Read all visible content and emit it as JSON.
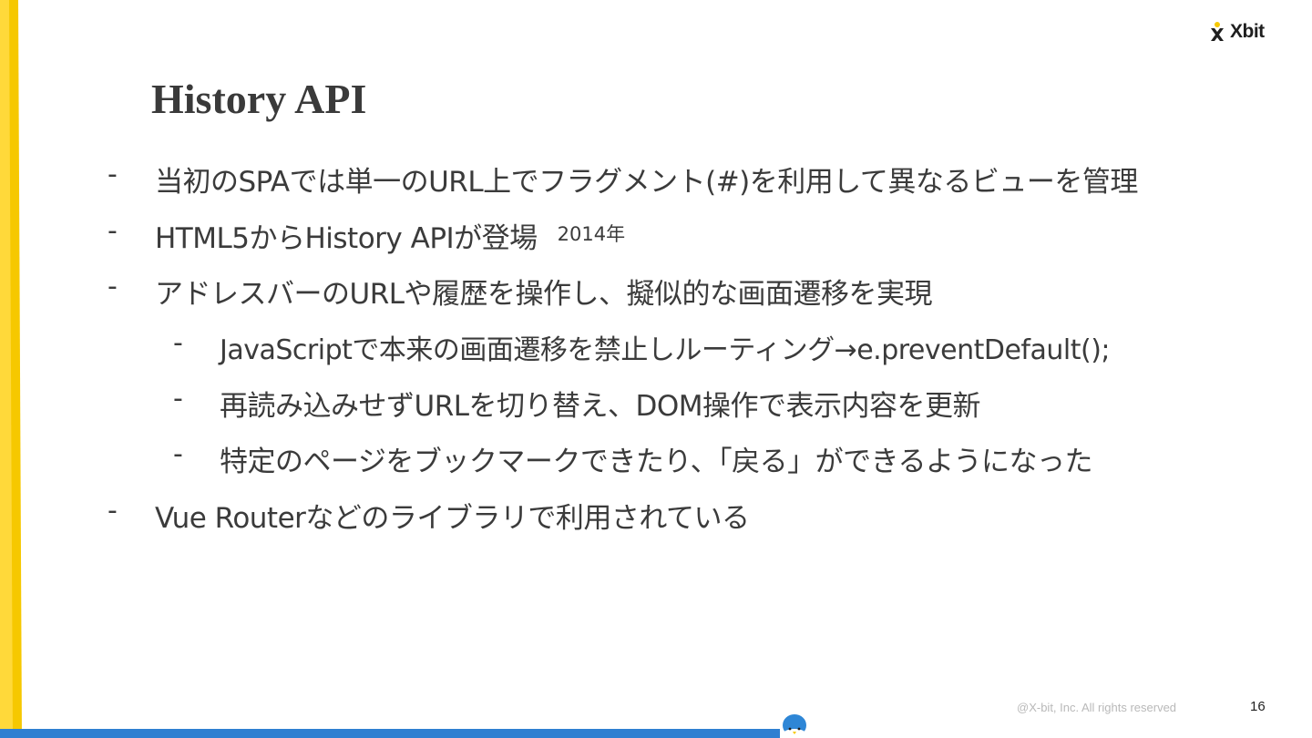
{
  "logo": {
    "text": "Xbit"
  },
  "slide": {
    "title": "History API",
    "bullets": [
      {
        "level": 1,
        "dash": "-",
        "text": "当初のSPAでは単一のURL上でフラグメント(#)を利用して異なるビューを管理"
      },
      {
        "level": 1,
        "dash": "-",
        "text": "HTML5からHistory APIが登場",
        "note": "2014年"
      },
      {
        "level": 1,
        "dash": "-",
        "text": "アドレスバーのURLや履歴を操作し、擬似的な画面遷移を実現"
      },
      {
        "level": 2,
        "dash": "-",
        "text": "JavaScriptで本来の画面遷移を禁止しルーティング→e.preventDefault();"
      },
      {
        "level": 2,
        "dash": "-",
        "text": "再読み込みせずURLを切り替え、DOM操作で表示内容を更新"
      },
      {
        "level": 2,
        "dash": "-",
        "text": "特定のページをブックマークできたり、「戻る」ができるようになった"
      },
      {
        "level": 1,
        "dash": "-",
        "text": "Vue Routerなどのライブラリで利用されている"
      }
    ]
  },
  "footer": {
    "copyright": "@X-bit, Inc.  All rights reserved",
    "page_number": "16"
  },
  "colors": {
    "accent_yellow": "#f6c800",
    "accent_blue": "#2f7fd1",
    "mascot_blue": "#2e86d6"
  }
}
